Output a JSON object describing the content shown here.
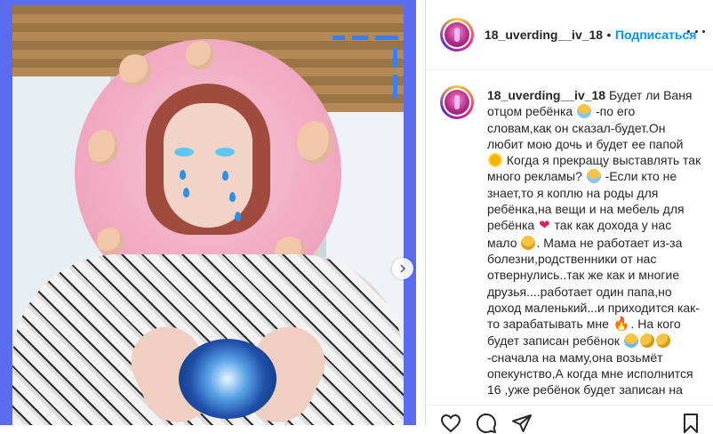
{
  "post": {
    "username": "18_uverding__iv_18",
    "dot": "•",
    "follow_label": "Подписаться",
    "caption_segments": [
      {
        "t": "Будет ли Ваня отцом ребёнка "
      },
      {
        "e": "emo-scream",
        "icon": "face-screaming-icon"
      },
      {
        "t": " -по его словам,как он сказал-будет.Он любит мою дочь и будет ее папой "
      },
      {
        "e": "emo-sun",
        "icon": "sun-icon"
      },
      {
        "t": " Когда я прекращу выставлять так много рекламы? "
      },
      {
        "e": "emo-scream",
        "icon": "face-screaming-icon"
      },
      {
        "t": " -Если кто не знает,то я коплю на роды для ребёнка,на вещи и на мебель для ребёнка "
      },
      {
        "e": "emo-heart",
        "icon": "heart-icon",
        "glyph": "❤"
      },
      {
        "t": " так как дохода у нас мало "
      },
      {
        "e": "emo-tired",
        "icon": "face-tired-icon"
      },
      {
        "t": ". Мама не работает из-за болезни,родственники от нас отвернулись..так же как и многие друзья....работает один папа,но доход маленький...и приходится как-то зарабатывать мне "
      },
      {
        "e": "emo-fire",
        "icon": "fire-icon",
        "glyph": "🔥"
      },
      {
        "t": ". На кого будет записан ребёнок "
      },
      {
        "e": "emo-joy",
        "icon": "face-joy-icon"
      },
      {
        "e": "emo-think",
        "icon": "face-thinking-icon"
      },
      {
        "e": "emo-think",
        "icon": "face-thinking-icon"
      },
      {
        "t": " -сначала на маму,она возьмёт опекунство,А когда мне исполнится 16 ,уже ребёнок будет записан на"
      }
    ]
  },
  "icons": {
    "next": "chevron-right-icon",
    "more": "more-options-icon",
    "like": "heart-outline-icon",
    "comment": "comment-icon",
    "share": "share-icon",
    "save": "bookmark-icon"
  },
  "colors": {
    "follow": "#0095f6",
    "photo_border": "#5b6cf0"
  }
}
